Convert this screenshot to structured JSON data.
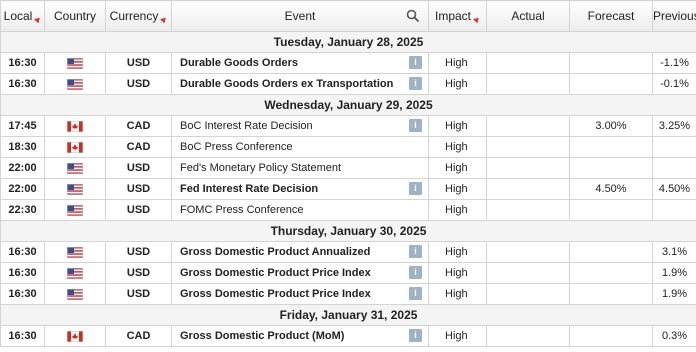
{
  "header": {
    "local": "Local",
    "country": "Country",
    "currency": "Currency",
    "event": "Event",
    "impact": "Impact",
    "actual": "Actual",
    "forecast": "Forecast",
    "previous": "Previous"
  },
  "groups": [
    {
      "date": "Tuesday, January 28, 2025",
      "rows": [
        {
          "time": "16:30",
          "flag": "us",
          "currency": "USD",
          "event": "Durable Goods Orders",
          "bold": true,
          "info": true,
          "impact": "High",
          "actual": "",
          "forecast": "",
          "previous": "-1.1%"
        },
        {
          "time": "16:30",
          "flag": "us",
          "currency": "USD",
          "event": "Durable Goods Orders ex Transportation",
          "bold": true,
          "info": true,
          "impact": "High",
          "actual": "",
          "forecast": "",
          "previous": "-0.1%"
        }
      ]
    },
    {
      "date": "Wednesday, January 29, 2025",
      "rows": [
        {
          "time": "17:45",
          "flag": "ca",
          "currency": "CAD",
          "event": "BoC Interest Rate Decision",
          "bold": false,
          "info": true,
          "impact": "High",
          "actual": "",
          "forecast": "3.00%",
          "previous": "3.25%"
        },
        {
          "time": "18:30",
          "flag": "ca",
          "currency": "CAD",
          "event": "BoC Press Conference",
          "bold": false,
          "info": false,
          "impact": "High",
          "actual": "",
          "forecast": "",
          "previous": ""
        },
        {
          "time": "22:00",
          "flag": "us",
          "currency": "USD",
          "event": "Fed's Monetary Policy Statement",
          "bold": false,
          "info": false,
          "impact": "High",
          "actual": "",
          "forecast": "",
          "previous": ""
        },
        {
          "time": "22:00",
          "flag": "us",
          "currency": "USD",
          "event": "Fed Interest Rate Decision",
          "bold": true,
          "info": true,
          "impact": "High",
          "actual": "",
          "forecast": "4.50%",
          "previous": "4.50%"
        },
        {
          "time": "22:30",
          "flag": "us",
          "currency": "USD",
          "event": "FOMC Press Conference",
          "bold": false,
          "info": false,
          "impact": "High",
          "actual": "",
          "forecast": "",
          "previous": ""
        }
      ]
    },
    {
      "date": "Thursday, January 30, 2025",
      "rows": [
        {
          "time": "16:30",
          "flag": "us",
          "currency": "USD",
          "event": "Gross Domestic Product Annualized",
          "bold": true,
          "info": true,
          "impact": "High",
          "actual": "",
          "forecast": "",
          "previous": "3.1%"
        },
        {
          "time": "16:30",
          "flag": "us",
          "currency": "USD",
          "event": "Gross Domestic Product Price Index",
          "bold": true,
          "info": true,
          "impact": "High",
          "actual": "",
          "forecast": "",
          "previous": "1.9%"
        },
        {
          "time": "16:30",
          "flag": "us",
          "currency": "USD",
          "event": "Gross Domestic Product Price Index",
          "bold": true,
          "info": true,
          "impact": "High",
          "actual": "",
          "forecast": "",
          "previous": "1.9%"
        }
      ]
    },
    {
      "date": "Friday, January 31, 2025",
      "rows": [
        {
          "time": "16:30",
          "flag": "ca",
          "currency": "CAD",
          "event": "Gross Domestic Product (MoM)",
          "bold": true,
          "info": true,
          "impact": "High",
          "actual": "",
          "forecast": "",
          "previous": "0.3%"
        }
      ]
    }
  ],
  "info_glyph": "i"
}
